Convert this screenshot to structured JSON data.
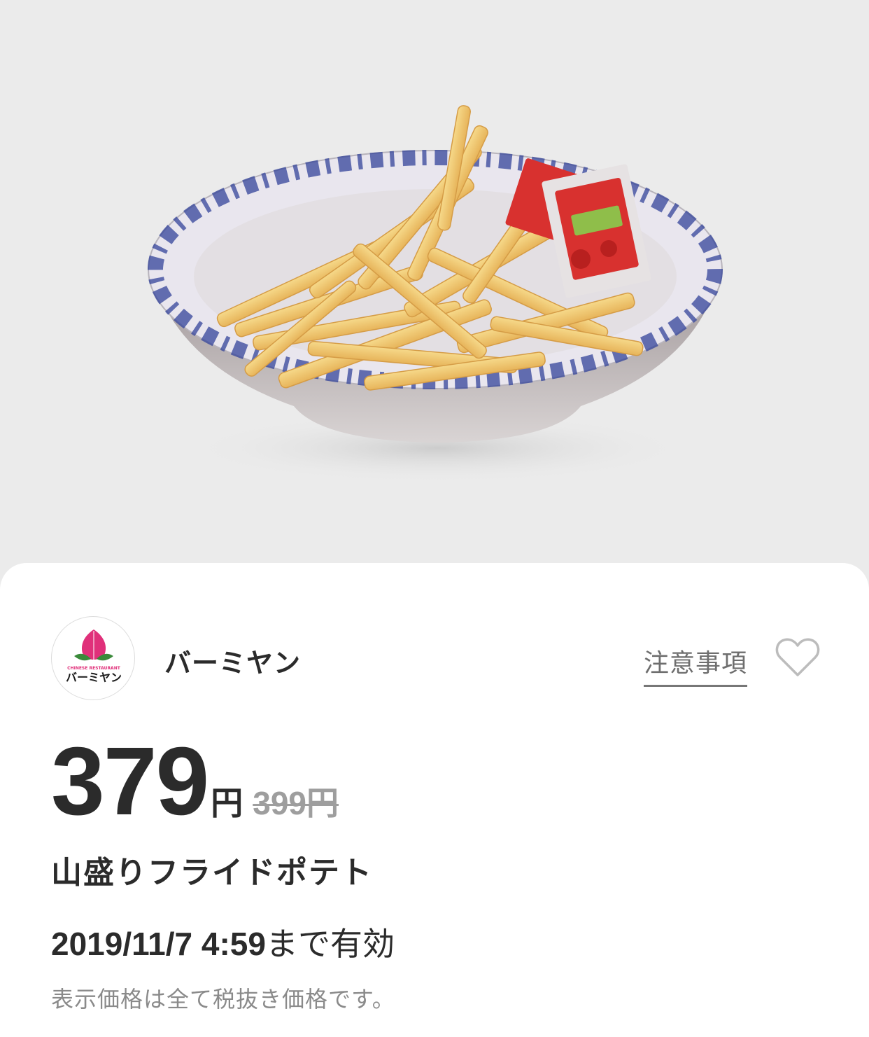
{
  "hero": {
    "image": "fries-plate-image"
  },
  "shop": {
    "logo_text": "CHINESE RESTAURANT",
    "logo_name": "バーミヤン",
    "name": "バーミヤン",
    "notes_label": "注意事項",
    "favorite_icon": "heart-outline-icon"
  },
  "offer": {
    "price": "379",
    "price_unit": "円",
    "original_price": "399円",
    "item_name": "山盛りフライドポテト",
    "valid_date": "2019/11/7 4:59",
    "valid_suffix": "まで有効",
    "tax_note": "表示価格は全て税抜き価格です。"
  },
  "colors": {
    "background": "#ebebeb",
    "card": "#ffffff",
    "text": "#2b2b2b",
    "muted": "#9e9e9e",
    "logo_pink": "#e0307a",
    "logo_green": "#3a8a3a"
  }
}
